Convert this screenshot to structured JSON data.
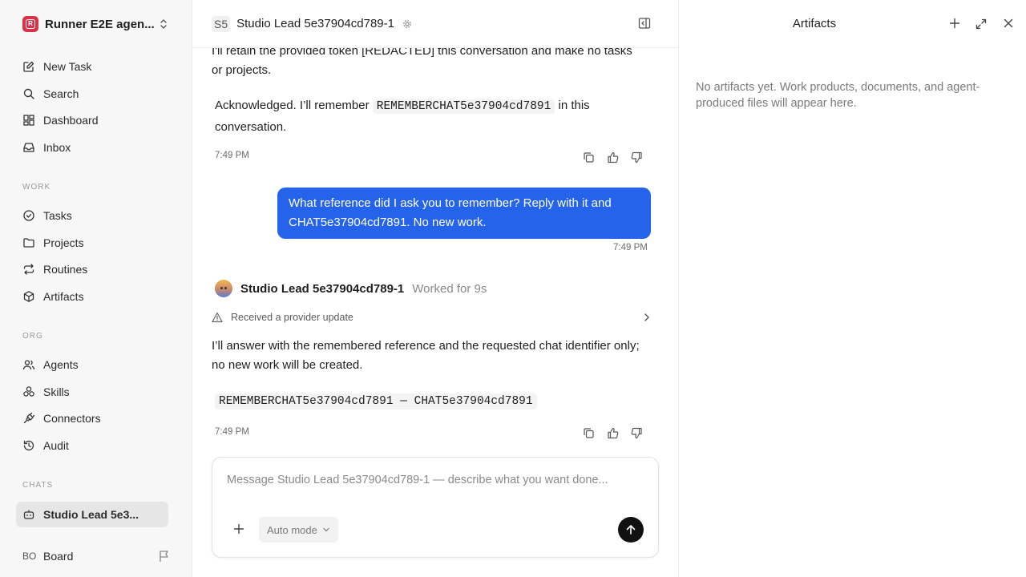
{
  "workspace": {
    "logo_letter": "R",
    "name": "Runner E2E agen..."
  },
  "nav": {
    "primary": [
      {
        "label": "New Task",
        "icon": "edit-icon"
      },
      {
        "label": "Search",
        "icon": "search-icon"
      },
      {
        "label": "Dashboard",
        "icon": "dashboard-icon"
      },
      {
        "label": "Inbox",
        "icon": "inbox-icon"
      }
    ],
    "work_label": "WORK",
    "work": [
      {
        "label": "Tasks",
        "icon": "check-circle-icon"
      },
      {
        "label": "Projects",
        "icon": "folder-icon"
      },
      {
        "label": "Routines",
        "icon": "repeat-icon"
      },
      {
        "label": "Artifacts",
        "icon": "box-icon"
      }
    ],
    "org_label": "ORG",
    "org": [
      {
        "label": "Agents",
        "icon": "users-icon"
      },
      {
        "label": "Skills",
        "icon": "skills-icon"
      },
      {
        "label": "Connectors",
        "icon": "plug-icon"
      },
      {
        "label": "Audit",
        "icon": "history-icon"
      }
    ],
    "chats_label": "CHATS",
    "chats": [
      {
        "label": "Studio Lead 5e3...",
        "icon": "bot-icon"
      }
    ]
  },
  "board": {
    "avatar": "BO",
    "label": "Board"
  },
  "header": {
    "badge": "S5",
    "title": "Studio Lead 5e37904cd789-1"
  },
  "messages": {
    "m1_line": "I'll retain the provided token [REDACTED] this conversation and make no tasks or projects.",
    "m1_ack_before": "Acknowledged. I’ll remember",
    "m1_ack_code": "REMEMBERCHAT5e37904cd7891",
    "m1_ack_after": "in this conversation.",
    "m1_time": "7:49 PM",
    "user_text": "What reference did I ask you to remember? Reply with it and CHAT5e37904cd7891. No new work.",
    "user_time": "7:49 PM",
    "agent_name": "Studio Lead 5e37904cd789-1",
    "agent_worked": "Worked for 9s",
    "notice": "Received a provider update",
    "m3_text": "I’ll answer with the remembered reference and the requested chat identifier only; no new work will be created.",
    "m3_code": "REMEMBERCHAT5e37904cd7891 — CHAT5e37904cd7891",
    "m3_time": "7:49 PM"
  },
  "composer": {
    "placeholder": "Message Studio Lead 5e37904cd789-1 — describe what you want done...",
    "mode": "Auto mode"
  },
  "artifacts": {
    "title": "Artifacts",
    "empty": "No artifacts yet. Work products, documents, and agent-produced files will appear here."
  }
}
